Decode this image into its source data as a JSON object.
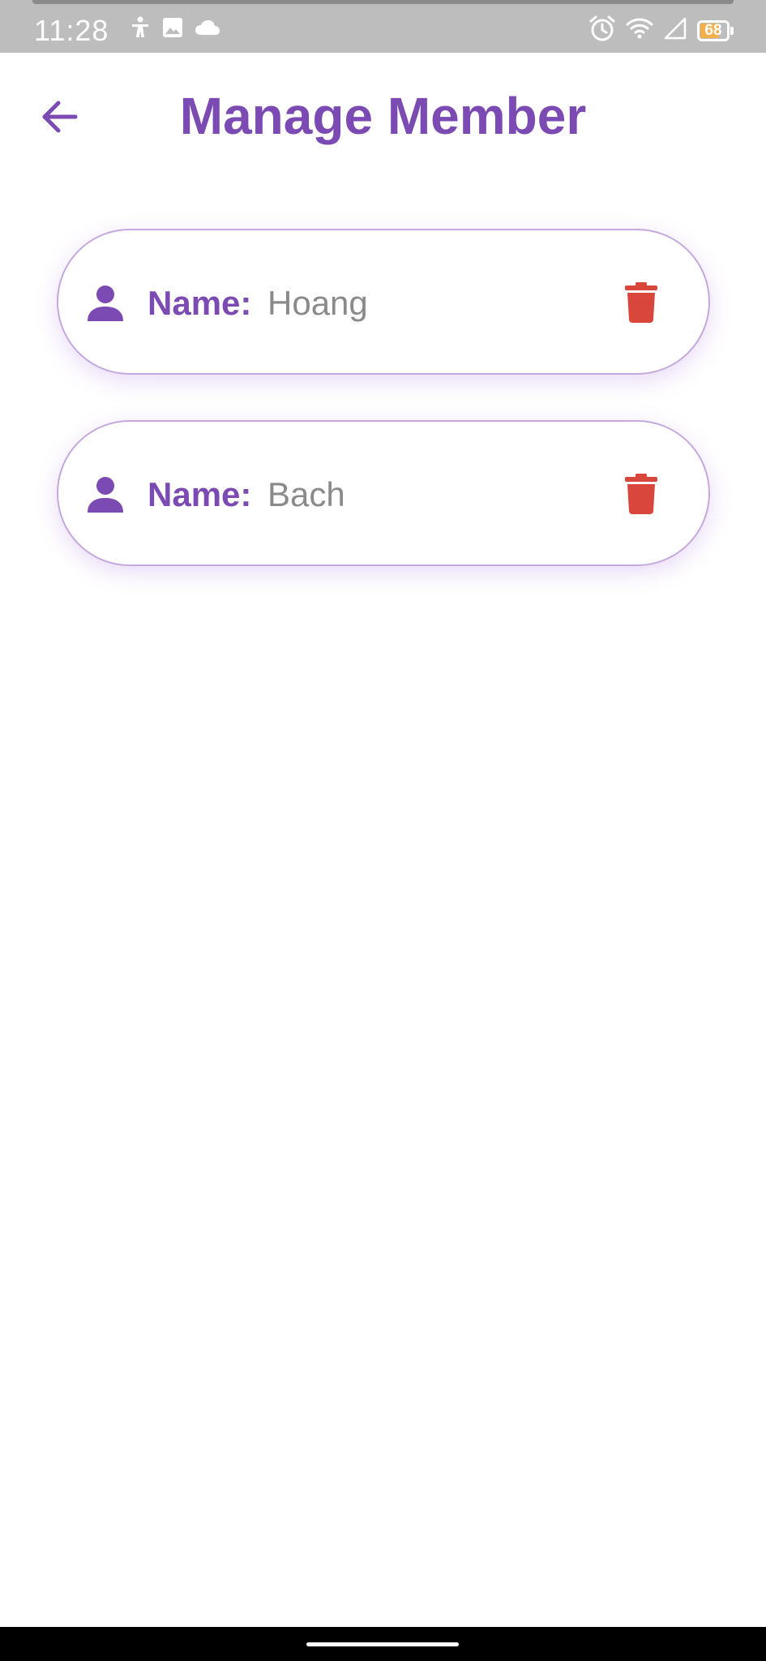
{
  "status_bar": {
    "time": "11:28",
    "battery_level": "68",
    "left_icons": [
      "accessibility-icon",
      "image-icon",
      "cloud-icon"
    ],
    "right_icons": [
      "alarm-icon",
      "wifi-icon",
      "signal-icon",
      "battery-icon"
    ]
  },
  "header": {
    "title": "Manage Member",
    "back_icon": "arrow-left-icon"
  },
  "members": [
    {
      "label": "Name:",
      "value": "Hoang",
      "icon": "person-icon",
      "delete_icon": "trash-icon"
    },
    {
      "label": "Name:",
      "value": "Bach",
      "icon": "person-icon",
      "delete_icon": "trash-icon"
    }
  ],
  "colors": {
    "accent": "#7b4bb3",
    "card_border": "#c4a8de",
    "delete": "#d9463b",
    "value_text": "#8a8a8a",
    "status_bar_bg": "#bdbdbd",
    "battery_fill": "#f3b04a"
  }
}
